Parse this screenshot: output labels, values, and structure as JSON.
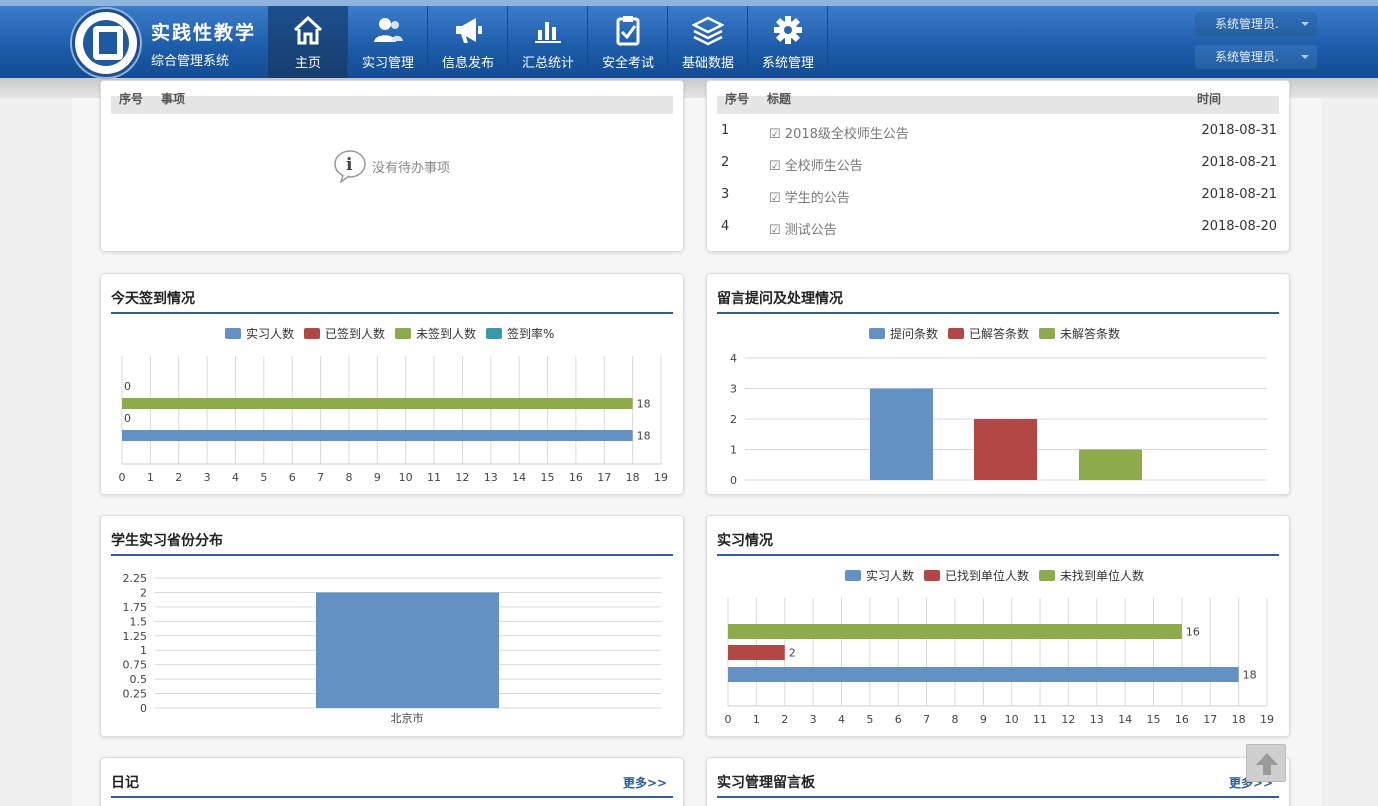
{
  "app": {
    "title": "实践性教学",
    "subtitle": "综合管理系统"
  },
  "nav": [
    {
      "label": "主页",
      "icon": "home-icon",
      "active": true
    },
    {
      "label": "实习管理",
      "icon": "users-icon"
    },
    {
      "label": "信息发布",
      "icon": "megaphone-icon"
    },
    {
      "label": "汇总统计",
      "icon": "bar-chart-icon"
    },
    {
      "label": "安全考试",
      "icon": "clipboard-check-icon"
    },
    {
      "label": "基础数据",
      "icon": "layers-icon"
    },
    {
      "label": "系统管理",
      "icon": "gear-icon"
    }
  ],
  "user": {
    "role1": "系统管理员.",
    "role2": "系统管理员."
  },
  "todo": {
    "col_index": "序号",
    "col_item": "事项",
    "empty_text": "没有待办事项"
  },
  "announcements": {
    "col_index": "序号",
    "col_title": "标题",
    "col_time": "时间",
    "rows": [
      {
        "no": "1",
        "title": "2018级全校师生公告",
        "date": "2018-08-31"
      },
      {
        "no": "2",
        "title": "全校师生公告",
        "date": "2018-08-21"
      },
      {
        "no": "3",
        "title": "学生的公告",
        "date": "2018-08-21"
      },
      {
        "no": "4",
        "title": "测试公告",
        "date": "2018-08-20"
      }
    ]
  },
  "panels": {
    "checkin_title": "今天签到情况",
    "questions_title": "留言提问及处理情况",
    "province_title": "学生实习省份分布",
    "internship_title": "实习情况",
    "diary_title": "日记",
    "board_title": "实习管理留言板",
    "more": "更多>>"
  },
  "chart_data": [
    {
      "type": "bar",
      "orientation": "horizontal",
      "series": [
        {
          "name": "实习人数",
          "value": 18,
          "color": "#6391c4"
        },
        {
          "name": "已签到人数",
          "value": 0,
          "color": "#b24845"
        },
        {
          "name": "未签到人数",
          "value": 18,
          "color": "#8daa4c"
        },
        {
          "name": "签到率%",
          "value": 0,
          "color": "#3a98ad"
        }
      ],
      "xlim": [
        0,
        19
      ],
      "xticks": [
        0,
        1,
        2,
        3,
        4,
        5,
        6,
        7,
        8,
        9,
        10,
        11,
        12,
        13,
        14,
        15,
        16,
        17,
        18,
        19
      ],
      "grid": true,
      "legend": "top"
    },
    {
      "type": "bar",
      "series": [
        {
          "name": "提问条数",
          "value": 3,
          "color": "#6391c4"
        },
        {
          "name": "已解答条数",
          "value": 2,
          "color": "#b24845"
        },
        {
          "name": "未解答条数",
          "value": 1,
          "color": "#8daa4c"
        }
      ],
      "ylim": [
        0,
        4
      ],
      "yticks": [
        0,
        1,
        2,
        3,
        4
      ],
      "grid": true,
      "legend": "top"
    },
    {
      "type": "bar",
      "categories": [
        "北京市"
      ],
      "values": [
        2
      ],
      "color": "#6391c4",
      "ylim": [
        0,
        2.25
      ],
      "yticks": [
        "0",
        "0.25",
        "0.5",
        "0.75",
        "1",
        "1.25",
        "1.5",
        "1.75",
        "2",
        "2.25"
      ],
      "grid": true
    },
    {
      "type": "bar",
      "orientation": "horizontal",
      "series": [
        {
          "name": "实习人数",
          "value": 18,
          "color": "#6391c4"
        },
        {
          "name": "已找到单位人数",
          "value": 2,
          "color": "#b24845"
        },
        {
          "name": "未找到单位人数",
          "value": 16,
          "color": "#8daa4c"
        }
      ],
      "xlim": [
        0,
        19
      ],
      "xticks": [
        0,
        1,
        2,
        3,
        4,
        5,
        6,
        7,
        8,
        9,
        10,
        11,
        12,
        13,
        14,
        15,
        16,
        17,
        18,
        19
      ],
      "grid": true,
      "legend": "top"
    }
  ]
}
